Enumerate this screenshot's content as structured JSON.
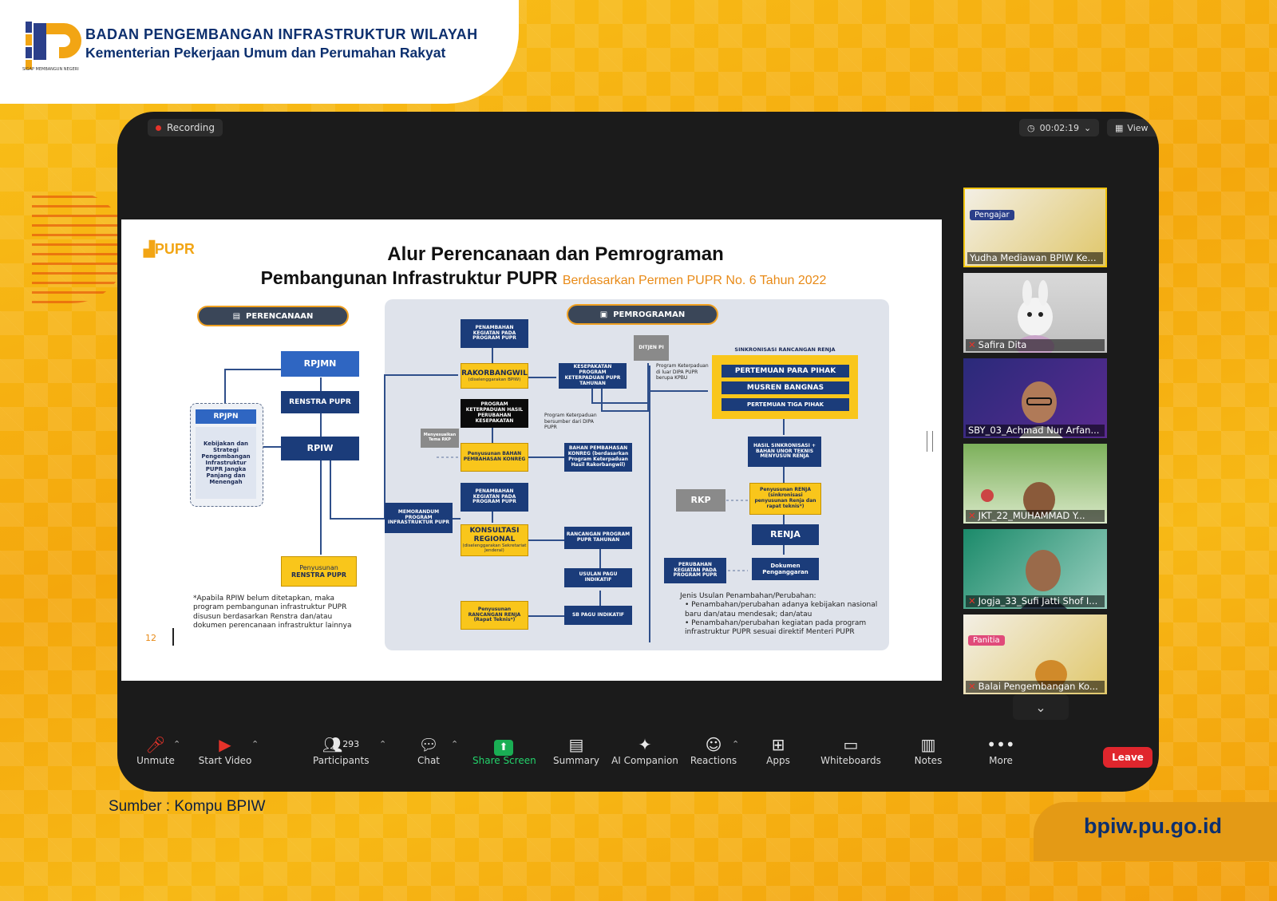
{
  "header": {
    "org_line1": "BADAN PENGEMBANGAN INFRASTRUKTUR WILAYAH",
    "org_line2": "Kementerian Pekerjaan Umum dan Perumahan Rakyat",
    "logo_tagline": "SIGAP MEMBANGUN NEGERI"
  },
  "meeting": {
    "recording_label": "Recording",
    "timer": "00:02:19",
    "view_label": "View"
  },
  "slide": {
    "logo_text": "PUPR",
    "title_line1": "Alur Perencanaan dan Pemrograman",
    "title_line2": "Pembangunan Infrastruktur PUPR",
    "title_sub": "Berdasarkan Permen PUPR No. 6 Tahun 2022",
    "section_perencanaan": "PERENCANAAN",
    "section_pemrograman": "PEMROGRAMAN",
    "rpjmn": "RPJMN",
    "renstra": "RENSTRA PUPR",
    "rpiw": "RPIW",
    "rpjpn": "RPJPN",
    "rpjpn_desc": "Kebijakan dan Strategi Pengembangan Infrastruktur PUPR Jangka Panjang dan Menengah",
    "penyusunan_renstra": "Penyusunan",
    "penyusunan_renstra_b": "RENSTRA PUPR",
    "footnote": "*Apabila RPIW belum ditetapkan, maka program pembangunan infrastruktur PUPR disusun berdasarkan Renstra dan/atau dokumen perencanaan infrastruktur lainnya",
    "page_number": "12",
    "memorandum": "MEMORANDUM PROGRAM INFRASTRUKTUR PUPR",
    "penambahan_1": "PENAMBAHAN KEGIATAN PADA PROGRAM PUPR",
    "rakorbangwil": "RAKORBANGWIL",
    "rakorbangwil_sub": "(diselenggarakan BPIW)",
    "program_keterpaduan": "PROGRAM KETERPADUAN HASIL PERUBAHAN KESEPAKATAN",
    "kesepakatan": "KESEPAKATAN PROGRAM KETERPADUAN PUPR TAHUNAN",
    "ditjen_pi": "DITJEN PI",
    "program_ket_note": "Program Keterpaduan di luar DIPA PUPR berupa KPBU",
    "program_ket_note2": "Program Keterpaduan bersumber dari DIPA PUPR",
    "menyesuaikan": "Menyesuaikan Tema RKP",
    "penyusunan_bahan": "Penyusunan BAHAN PEMBAHASAN KONREG",
    "bahan_pembahasan": "BAHAN PEMBAHASAN KONREG (berdasarkan Program Keterpaduan Hasil Rakorbangwil)",
    "penambahan_2": "PENAMBAHAN KEGIATAN PADA PROGRAM PUPR",
    "konsultasi": "KONSULTASI REGIONAL",
    "konsultasi_sub": "(diselenggarakan Sekretariat Jenderal)",
    "rancangan_program": "RANCANGAN PROGRAM PUPR TAHUNAN",
    "usulan_pagu": "USULAN PAGU INDIKATIF",
    "penyusunan_rancangan": "Penyusunan RANCANGAN RENJA (Rapat Teknis*)",
    "sb_pagu": "SB PAGU INDIKATIF",
    "sinkronisasi_title": "SINKRONISASI RANCANGAN RENJA",
    "sync_items": [
      "PERTEMUAN PARA PIHAK",
      "MUSREN BANGNAS",
      "PERTEMUAN TIGA PIHAK"
    ],
    "hasil_sinkronisasi": "HASIL SINKRONISASI + BAHAN UNOR TEKNIS MENYUSUN RENJA",
    "rkp": "RKP",
    "penyusunan_renja": "Penyusunan RENJA (sinkronisasi penyusunan Renja dan rapat teknis*)",
    "renja": "RENJA",
    "perubahan": "PERUBAHAN KEGIATAN PADA PROGRAM PUPR",
    "dokumen": "Dokumen Penganggaran",
    "jenis_title": "Jenis Usulan Penambahan/Perubahan:",
    "jenis_items": [
      "Penambahan/perubahan adanya kebijakan nasional baru dan/atau mendesak; dan/atau",
      "Penambahan/perubahan kegiatan pada program infrastruktur PUPR sesuai direktif Menteri PUPR"
    ]
  },
  "participants": [
    {
      "name": "Yudha Mediawan BPIW Ke...",
      "tag": "Pengajar",
      "muted": false
    },
    {
      "name": "Safira Dita",
      "tag": "",
      "muted": true
    },
    {
      "name": "SBY_03_Achmad Nur Arfan...",
      "tag": "",
      "muted": false
    },
    {
      "name": "JKT_22_MUHAMMAD Y...",
      "tag": "",
      "muted": true
    },
    {
      "name": "Jogja_33_Sufi Jatti Shof I...",
      "tag": "",
      "muted": true
    },
    {
      "name": "Balai Pengembangan Ko...",
      "tag": "Panitia",
      "muted": true
    }
  ],
  "toolbar": {
    "unmute": "Unmute",
    "start_video": "Start Video",
    "participants": "Participants",
    "participants_count": "293",
    "chat": "Chat",
    "share_screen": "Share Screen",
    "summary": "Summary",
    "ai_companion": "AI Companion",
    "reactions": "Reactions",
    "apps": "Apps",
    "whiteboards": "Whiteboards",
    "notes": "Notes",
    "more": "More",
    "leave": "Leave"
  },
  "footer": {
    "source": "Sumber : Kompu BPIW",
    "url": "bpiw.pu.go.id"
  },
  "colors": {
    "brand_navy": "#0c2f6e",
    "accent_yellow": "#f9c61b",
    "leave_red": "#e0262d",
    "share_green": "#1aae54"
  }
}
